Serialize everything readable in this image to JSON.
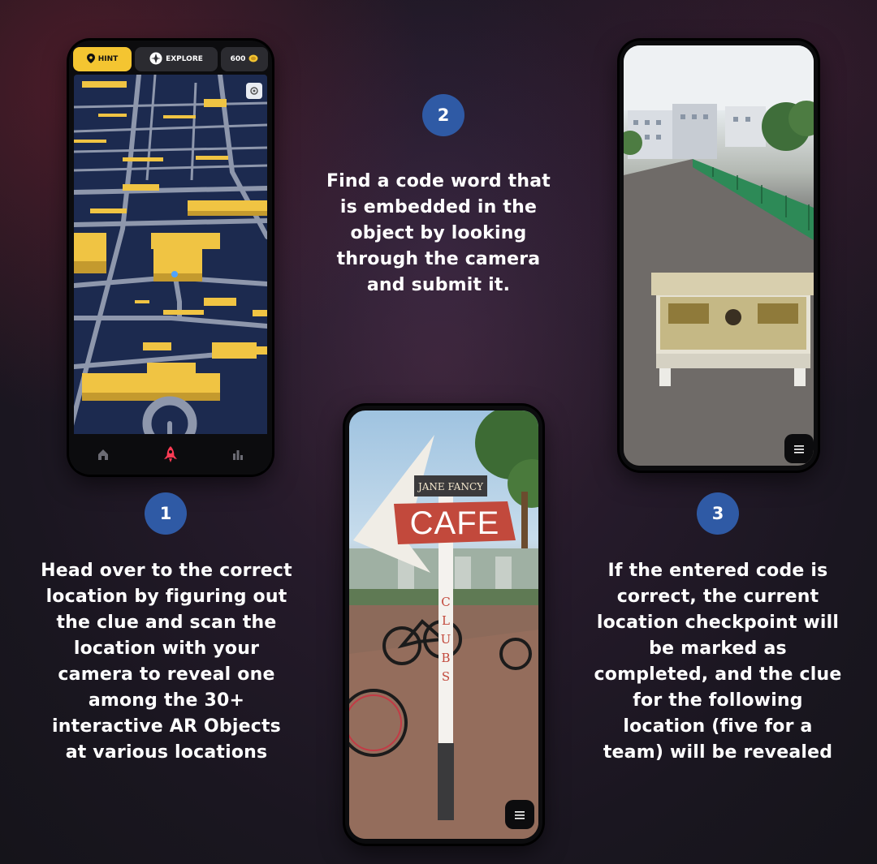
{
  "app": {
    "hint_label": "HINT",
    "explore_label": "EXPLORE",
    "coins_value": "600"
  },
  "sign": {
    "top_text": "JANE FANCY",
    "main_text": "CAFE",
    "vertical_text": "CLUBS"
  },
  "steps": [
    {
      "number": "1",
      "text": "Head over to the correct location by figuring out the clue and scan the location with your camera to reveal one among the 30+ interactive AR Objects at various locations"
    },
    {
      "number": "2",
      "text": "Find a code word that is embedded in the object by looking through the camera and submit it."
    },
    {
      "number": "3",
      "text": "If the entered code is correct, the current location checkpoint will be marked as completed, and the clue for the following location (five for a team) will be revealed"
    }
  ],
  "colors": {
    "badge": "#2f5aa5",
    "hint_pill": "#f4c531",
    "map_bg": "#1c2a4f",
    "building": "#f0c443",
    "active_nav": "#ff3b54"
  },
  "icons": [
    "location-pin-icon",
    "compass-icon",
    "coin-icon",
    "recenter-icon",
    "home-icon",
    "rocket-icon",
    "leaderboard-icon",
    "menu-icon"
  ]
}
